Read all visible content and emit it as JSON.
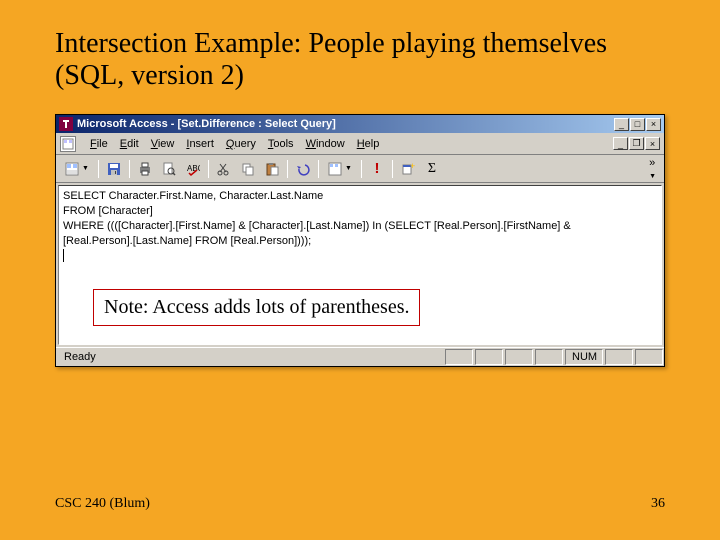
{
  "slide": {
    "title": "Intersection Example: People playing themselves (SQL, version 2)",
    "footer_left": "CSC 240 (Blum)",
    "footer_right": "36"
  },
  "window": {
    "title": "Microsoft Access - [Set.Difference : Select Query]",
    "menus": {
      "file": "File",
      "edit": "Edit",
      "view": "View",
      "insert": "Insert",
      "query": "Query",
      "tools": "Tools",
      "window": "Window",
      "help": "Help"
    },
    "sql": {
      "line1": "SELECT Character.First.Name, Character.Last.Name",
      "line2": "FROM [Character]",
      "line3": "WHERE ((([Character].[First.Name] & [Character].[Last.Name]) In (SELECT [Real.Person].[FirstName] &",
      "line4": "[Real.Person].[Last.Name] FROM [Real.Person])));"
    },
    "note": "Note: Access adds lots of parentheses.",
    "status": {
      "ready": "Ready",
      "num": "NUM"
    }
  }
}
